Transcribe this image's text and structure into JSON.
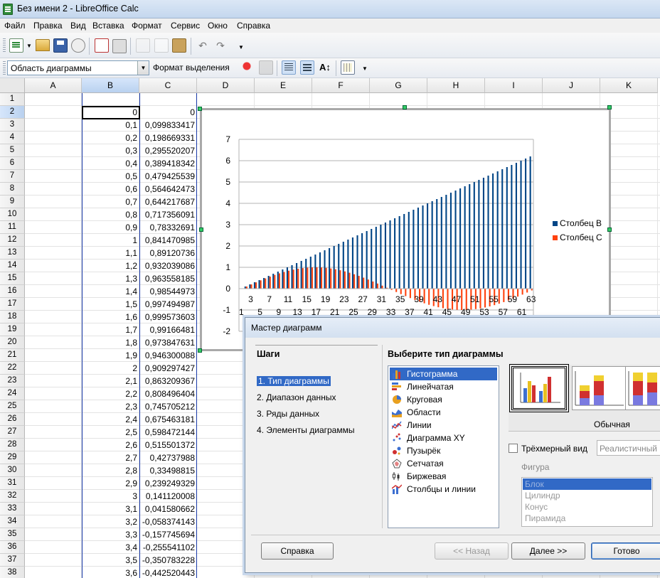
{
  "window": {
    "title": "Без имени 2 - LibreOffice Calc"
  },
  "menu": [
    "Файл",
    "Правка",
    "Вид",
    "Вставка",
    "Формат",
    "Сервис",
    "Окно",
    "Справка"
  ],
  "format_toolbar": {
    "selection": "Область диаграммы",
    "format_selection_label": "Формат выделения"
  },
  "columns": [
    "A",
    "B",
    "C",
    "D",
    "E",
    "F",
    "G",
    "H",
    "I",
    "J",
    "K"
  ],
  "rows": [
    "1",
    "2",
    "3",
    "4",
    "5",
    "6",
    "7",
    "8",
    "9",
    "10",
    "11",
    "12",
    "13",
    "14",
    "15",
    "16",
    "17",
    "18",
    "19",
    "20",
    "21",
    "22",
    "23",
    "24",
    "25",
    "26",
    "27",
    "28",
    "29",
    "30",
    "31",
    "32",
    "33",
    "34",
    "35",
    "36",
    "37",
    "38"
  ],
  "colB": [
    "",
    "0",
    "0,1",
    "0,2",
    "0,3",
    "0,4",
    "0,5",
    "0,6",
    "0,7",
    "0,8",
    "0,9",
    "1",
    "1,1",
    "1,2",
    "1,3",
    "1,4",
    "1,5",
    "1,6",
    "1,7",
    "1,8",
    "1,9",
    "2",
    "2,1",
    "2,2",
    "2,3",
    "2,4",
    "2,5",
    "2,6",
    "2,7",
    "2,8",
    "2,9",
    "3",
    "3,1",
    "3,2",
    "3,3",
    "3,4",
    "3,5",
    "3,6"
  ],
  "colC": [
    "",
    "0",
    "0,099833417",
    "0,198669331",
    "0,295520207",
    "0,389418342",
    "0,479425539",
    "0,564642473",
    "0,644217687",
    "0,717356091",
    "0,78332691",
    "0,841470985",
    "0,89120736",
    "0,932039086",
    "0,963558185",
    "0,98544973",
    "0,997494987",
    "0,999573603",
    "0,99166481",
    "0,973847631",
    "0,946300088",
    "0,909297427",
    "0,863209367",
    "0,808496404",
    "0,745705212",
    "0,675463181",
    "0,598472144",
    "0,515501372",
    "0,42737988",
    "0,33498815",
    "0,239249329",
    "0,141120008",
    "0,041580662",
    "-0,058374143",
    "-0,157745694",
    "-0,255541102",
    "-0,350783228",
    "-0,442520443"
  ],
  "chart_data": {
    "type": "bar",
    "x_count": 63,
    "x_start": 1,
    "ylim": [
      -2,
      7
    ],
    "y_ticks": [
      "-2",
      "-1",
      "0",
      "1",
      "2",
      "3",
      "4",
      "5",
      "6",
      "7"
    ],
    "x_ticks_odd": [
      "1",
      "5",
      "9",
      "13",
      "17",
      "21",
      "25",
      "29",
      "33",
      "37",
      "41",
      "45",
      "49",
      "53",
      "57",
      "61"
    ],
    "x_ticks_even": [
      "3",
      "7",
      "11",
      "15",
      "19",
      "23",
      "27",
      "31",
      "35",
      "39",
      "43",
      "47",
      "51",
      "55",
      "59",
      "63"
    ],
    "grid": true,
    "legend_placement": "right",
    "series": [
      {
        "name": "Столбец B",
        "color": "#004586",
        "formula": "(i-1)*0.1",
        "step": 0.1
      },
      {
        "name": "Столбец C",
        "color": "#ff420e",
        "formula": "sin((i-1)*0.1)",
        "step": 0.1
      }
    ]
  },
  "wizard": {
    "title": "Мастер диаграмм",
    "steps_heading": "Шаги",
    "steps": [
      "1. Тип диаграммы",
      "2. Диапазон данных",
      "3. Ряды данных",
      "4. Элементы диаграммы"
    ],
    "type_heading": "Выберите тип диаграммы",
    "types": [
      "Гистограмма",
      "Линейчатая",
      "Круговая",
      "Области",
      "Линии",
      "Диаграмма XY",
      "Пузырёк",
      "Сетчатая",
      "Биржевая",
      "Столбцы и линии"
    ],
    "subtype_label": "Обычная",
    "three_d_label": "Трёхмерный вид",
    "three_d_style": "Реалистичный",
    "shape_label": "Фигура",
    "shapes": [
      "Блок",
      "Цилиндр",
      "Конус",
      "Пирамида"
    ],
    "buttons": {
      "help": "Справка",
      "back": "<< Назад",
      "next": "Далее >>",
      "finish": "Готово"
    }
  }
}
